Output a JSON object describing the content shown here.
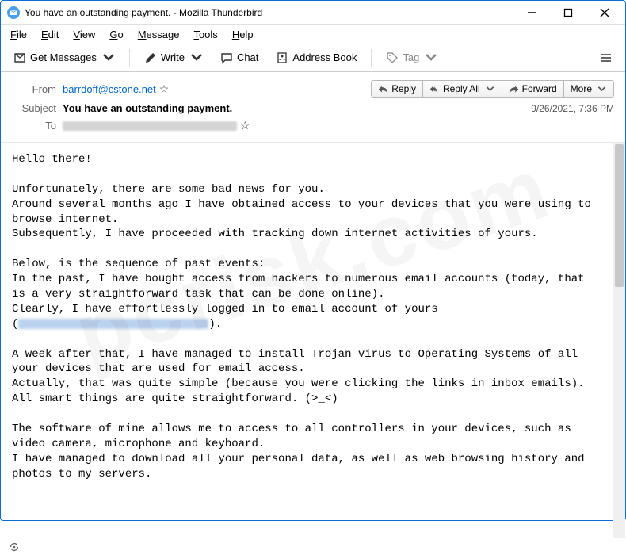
{
  "window": {
    "title": "You have an outstanding payment. - Mozilla Thunderbird"
  },
  "menu": {
    "file": "File",
    "edit": "Edit",
    "view": "View",
    "go": "Go",
    "message": "Message",
    "tools": "Tools",
    "help": "Help"
  },
  "toolbar": {
    "get_messages": "Get Messages",
    "write": "Write",
    "chat": "Chat",
    "address_book": "Address Book",
    "tag": "Tag"
  },
  "header": {
    "from_label": "From",
    "from_value": "barrdoff@cstone.net",
    "subject_label": "Subject",
    "subject_value": "You have an outstanding payment.",
    "to_label": "To",
    "date": "9/26/2021, 7:36 PM"
  },
  "actions": {
    "reply": "Reply",
    "reply_all": "Reply All",
    "forward": "Forward",
    "more": "More"
  },
  "body": {
    "p1": "Hello there!",
    "p2": "Unfortunately, there are some bad news for you.\nAround several months ago I have obtained access to your devices that you were using to browse internet.\nSubsequently, I have proceeded with tracking down internet activities of yours.",
    "p3a": "Below, is the sequence of past events:\nIn the past, I have bought access from hackers to numerous email accounts (today, that is a very straightforward task that can be done online).\nClearly, I have effortlessly logged in to email account of yours\n(",
    "p3b": ").",
    "p4": "A week after that, I have managed to install Trojan virus to Operating Systems of all your devices that are used for email access.\nActually, that was quite simple (because you were clicking the links in inbox emails).\nAll smart things are quite straightforward. (>_<)",
    "p5": "The software of mine allows me to access to all controllers in your devices, such as video camera, microphone and keyboard.\nI have managed to download all your personal data, as well as web browsing history and photos to my servers."
  }
}
